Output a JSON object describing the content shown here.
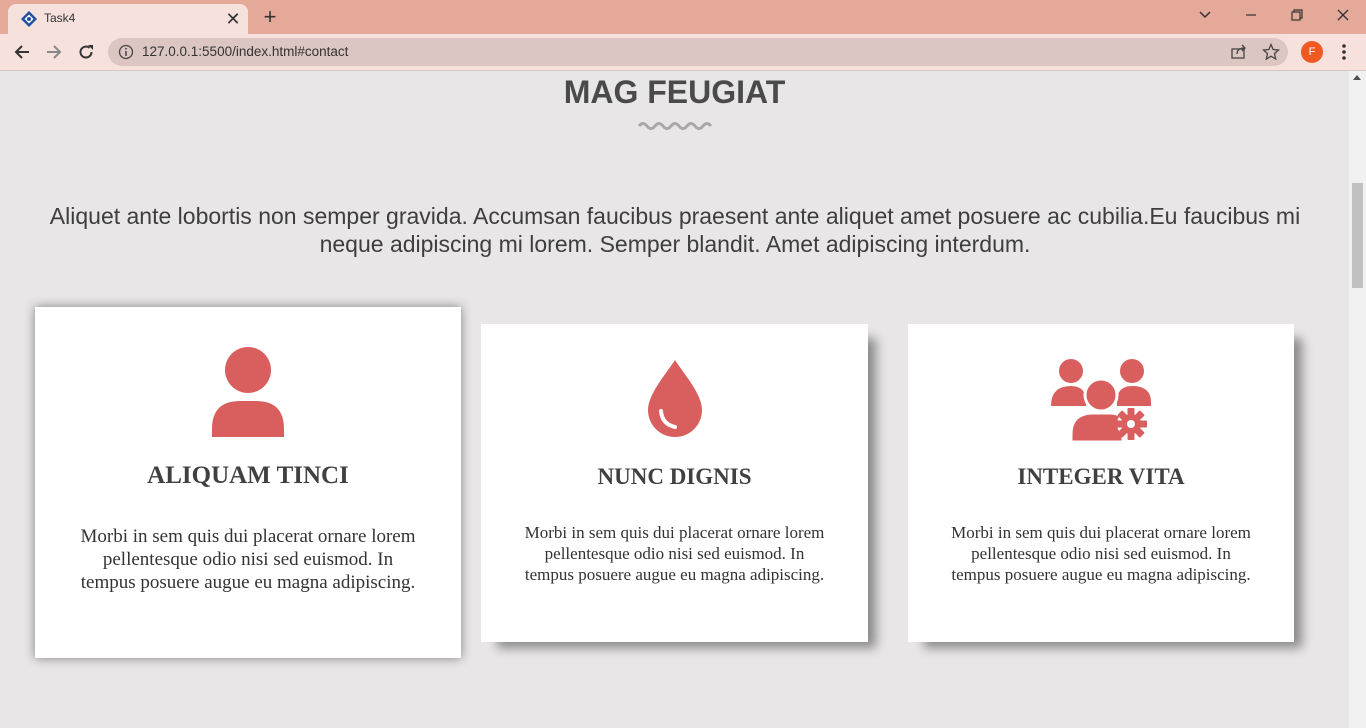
{
  "browser": {
    "tab_title": "Task4",
    "url": "127.0.0.1:5500/index.html#contact",
    "profile_initial": "F"
  },
  "section": {
    "heading": "MAG FEUGIAT",
    "intro": "Aliquet ante lobortis non semper gravida. Accumsan faucibus praesent ante aliquet amet posuere ac cubilia.Eu faucibus mi neque adipiscing mi lorem. Semper blandit. Amet adipiscing interdum."
  },
  "cards": [
    {
      "icon": "user-icon",
      "title": "ALIQUAM TINCI",
      "text": "Morbi in sem quis dui placerat ornare lorem pellentesque odio nisi sed euismod. In tempus posuere augue eu magna adipiscing."
    },
    {
      "icon": "droplet-icon",
      "title": "NUNC DIGNIS",
      "text": "Morbi in sem quis dui placerat ornare lorem pellentesque odio nisi sed euismod. In tempus posuere augue eu magna adipiscing."
    },
    {
      "icon": "users-gear-icon",
      "title": "INTEGER VITA",
      "text": "Morbi in sem quis dui placerat ornare lorem pellentesque odio nisi sed euismod. In tempus posuere augue eu magna adipiscing."
    }
  ],
  "colors": {
    "accent": "#d95f5f",
    "tabbar": "#e4a998",
    "toolbar": "#f7e1dc",
    "page_bg": "#e8e6e6"
  }
}
